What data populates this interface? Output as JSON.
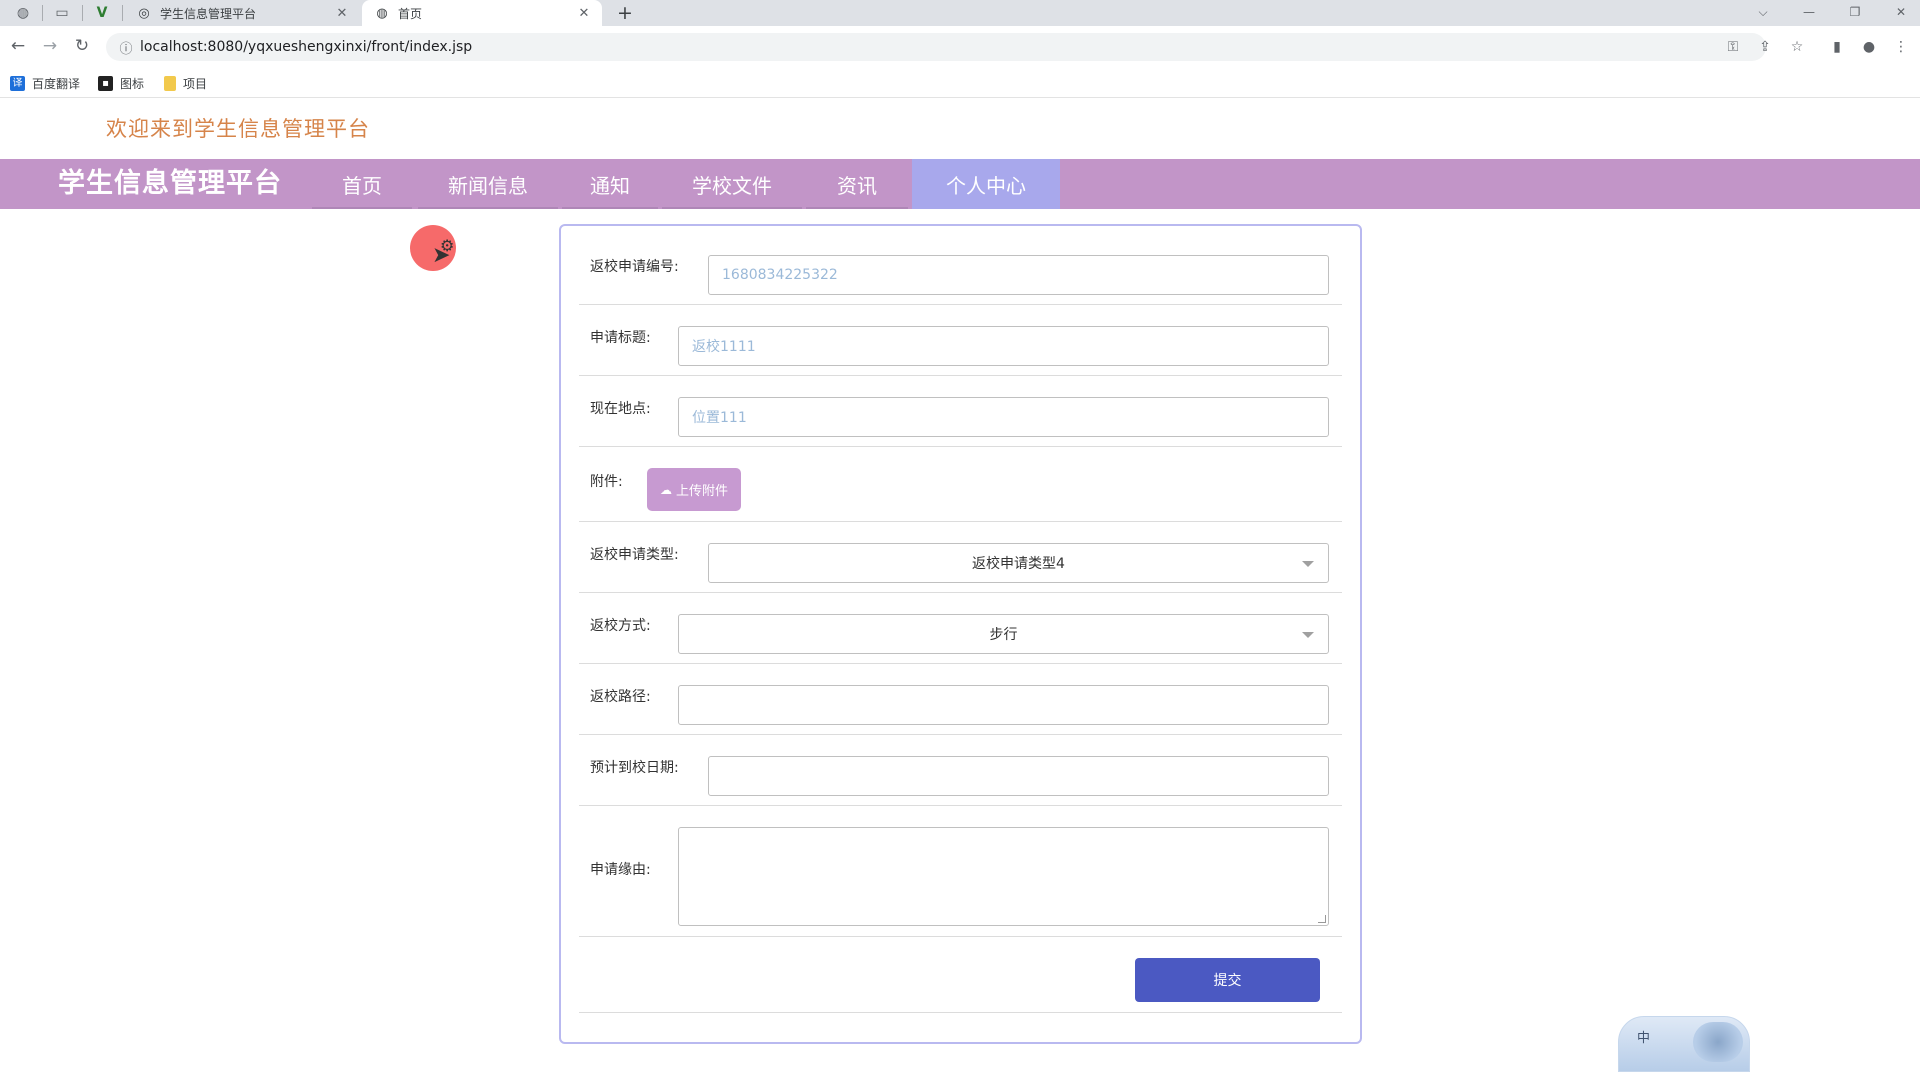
{
  "browser": {
    "tabs": [
      {
        "title": "学生信息管理平台",
        "icon": "site-icon"
      },
      {
        "title": "首页",
        "icon": "globe-icon"
      }
    ],
    "tab_close_glyph": "✕",
    "new_tab_glyph": "+",
    "url": "localhost:8080/yqxueshengxinxi/front/index.jsp",
    "bookmarks": [
      {
        "label": "百度翻译",
        "icon": "translate-icon",
        "color": "#1e6fd9"
      },
      {
        "label": "图标",
        "icon": "image-icon",
        "color": "#222222"
      },
      {
        "label": "项目",
        "icon": "folder-icon",
        "color": "#f2c94c"
      }
    ]
  },
  "page": {
    "welcome": "欢迎来到学生信息管理平台",
    "brand": "学生信息管理平台",
    "nav": [
      "首页",
      "新闻信息",
      "通知",
      "学校文件",
      "资讯",
      "个人中心"
    ],
    "active_nav": "个人中心",
    "colors": {
      "navbar": "#c295c8",
      "nav_active": "#a8a8ec",
      "welcome": "#d6844a",
      "submit": "#4b59c2",
      "upload": "#c79ad1"
    }
  },
  "form": {
    "fields": [
      {
        "label": "返校申请编号:",
        "value": "1680834225322"
      },
      {
        "label": "申请标题:",
        "value": "返校1111"
      },
      {
        "label": "现在地点:",
        "value": "位置111"
      },
      {
        "label": "附件:",
        "button": "上传附件"
      },
      {
        "label": "返校申请类型:",
        "value": "返校申请类型4"
      },
      {
        "label": "返校方式:",
        "value": "步行"
      },
      {
        "label": "返校路径:",
        "value": ""
      },
      {
        "label": "预计到校日期:",
        "value": ""
      },
      {
        "label": "申请缘由:",
        "value": ""
      }
    ],
    "submit_label": "提交"
  },
  "ime": {
    "label": "中"
  }
}
